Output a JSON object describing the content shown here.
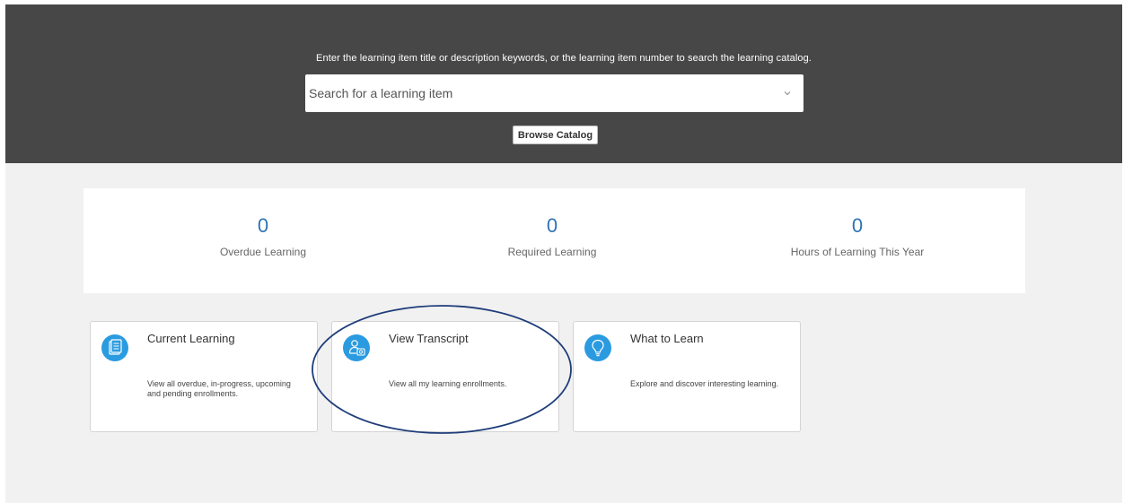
{
  "hero": {
    "instructions": "Enter the learning item title or description keywords, or the learning item number to search the learning catalog.",
    "search_placeholder": "Search for a learning item",
    "search_value": "",
    "browse_label": "Browse Catalog"
  },
  "stats": [
    {
      "value": "0",
      "label": "Overdue Learning"
    },
    {
      "value": "0",
      "label": "Required Learning"
    },
    {
      "value": "0",
      "label": "Hours of Learning This Year"
    }
  ],
  "cards": [
    {
      "title": "Current Learning",
      "description": "View all overdue, in-progress, upcoming and pending enrollments.",
      "icon": "document-list-icon"
    },
    {
      "title": "View Transcript",
      "description": "View all my learning enrollments.",
      "icon": "user-transcript-icon"
    },
    {
      "title": "What to Learn",
      "description": "Explore and discover interesting learning.",
      "icon": "lightbulb-icon"
    }
  ],
  "colors": {
    "hero_background": "#474747",
    "page_background": "#f1f1f1",
    "accent_blue": "#2a9be0",
    "stat_value_blue": "#2f74b5",
    "annotation_ellipse": "#1f3d7a"
  }
}
